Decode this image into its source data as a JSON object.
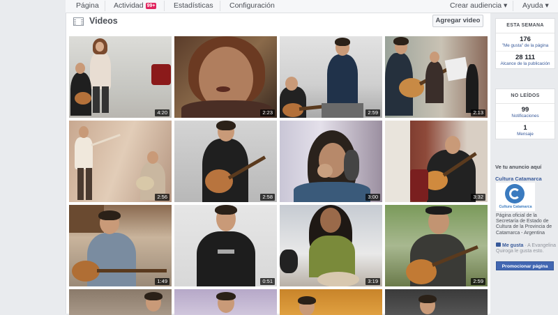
{
  "topnav": {
    "items": [
      "Página",
      "Actividad",
      "Estadísticas",
      "Configuración"
    ],
    "activity_badge": "99+",
    "right": [
      "Crear audiencia ▾",
      "Ayuda ▾"
    ]
  },
  "main": {
    "title": "Videos",
    "add_video_label": "Agregar video",
    "videos": [
      {
        "duration": "4:20"
      },
      {
        "duration": "2:23"
      },
      {
        "duration": "2:59"
      },
      {
        "duration": "2:13"
      },
      {
        "duration": "2:56"
      },
      {
        "duration": "2:58"
      },
      {
        "duration": "3:00"
      },
      {
        "duration": "3:32"
      },
      {
        "duration": "1:49"
      },
      {
        "duration": "0:51"
      },
      {
        "duration": "3:19"
      },
      {
        "duration": "2:59"
      },
      {
        "duration": ""
      },
      {
        "duration": ""
      },
      {
        "duration": ""
      },
      {
        "duration": ""
      }
    ]
  },
  "sidebar": {
    "this_week": {
      "title": "ESTA SEMANA",
      "likes_value": "176",
      "likes_label": "\"Me gusta\" de la página",
      "reach_value": "28 111",
      "reach_label": "Alcance de la publicación"
    },
    "unread": {
      "title": "NO LEÍDOS",
      "notifications_value": "99",
      "notifications_label": "Notificaciones",
      "messages_value": "1",
      "messages_label": "Mensaje"
    },
    "ad": {
      "section_title": "Ve tu anuncio aquí",
      "page_name": "Cultura Catamarca",
      "logo_text": "Cultura Catamarca",
      "description": "Página oficial de la Secretaría de Estado de Cultura de la Provincia de Catamarca - Argentina",
      "like_link": "Me gusta",
      "like_text": " · A Evangelina Quiroga le gusta esto.",
      "promote_label": "Promocionar página"
    }
  },
  "colors": {
    "accent": "#4267b2",
    "link": "#365899",
    "badge": "#e0245e",
    "background": "#e9ebee"
  }
}
